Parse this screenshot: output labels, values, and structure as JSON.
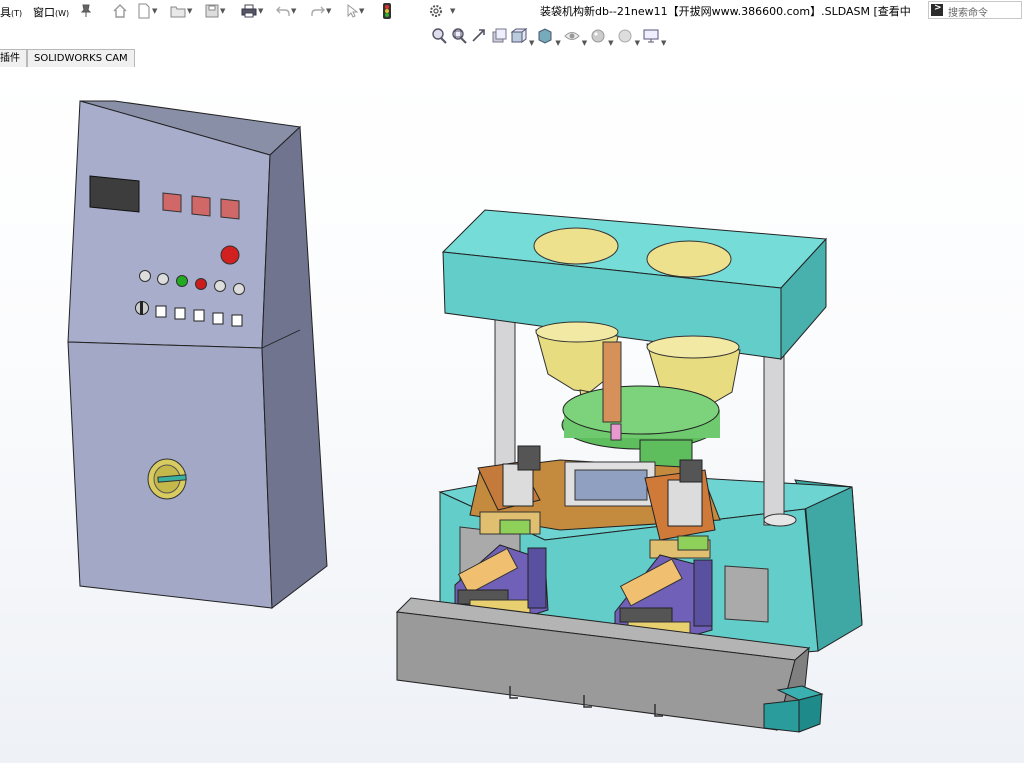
{
  "menubar": {
    "tools_menu": "具",
    "tools_key": "(T)",
    "window_menu": "窗口",
    "window_key": "(W)"
  },
  "window": {
    "title": "装袋机构新db--21new11【开拔网www.386600.com】.SLDASM [查看中"
  },
  "search": {
    "placeholder": "搜索命令"
  },
  "tabs": [
    {
      "label": "插件"
    },
    {
      "label": "SOLIDWORKS CAM"
    }
  ],
  "colors": {
    "frame_cyan": "#62cfcc",
    "cabinet_grey": "#a3a8c8",
    "hopper_yellow": "#ede18d",
    "tray_grey": "#9a9a9a",
    "disc_green": "#6fc96e"
  }
}
